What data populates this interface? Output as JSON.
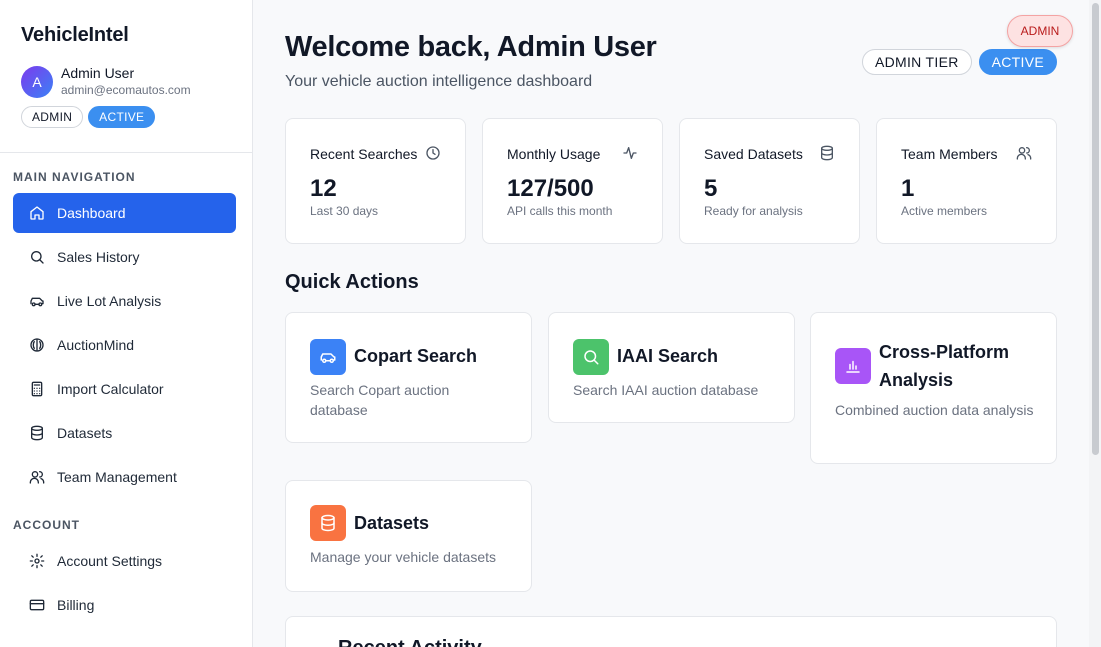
{
  "app": {
    "brand": "VehicleIntel"
  },
  "user": {
    "initial": "A",
    "name": "Admin User",
    "email": "admin@ecomautos.com",
    "role_badge": "ADMIN",
    "status_badge": "ACTIVE"
  },
  "sidebar": {
    "main_label": "MAIN NAVIGATION",
    "main_items": [
      {
        "label": "Dashboard",
        "icon": "home-icon",
        "active": true
      },
      {
        "label": "Sales History",
        "icon": "search-icon"
      },
      {
        "label": "Live Lot Analysis",
        "icon": "car-icon"
      },
      {
        "label": "AuctionMind",
        "icon": "brain-icon"
      },
      {
        "label": "Import Calculator",
        "icon": "calculator-icon"
      },
      {
        "label": "Datasets",
        "icon": "database-icon"
      },
      {
        "label": "Team Management",
        "icon": "users-icon"
      }
    ],
    "account_label": "ACCOUNT",
    "account_items": [
      {
        "label": "Account Settings",
        "icon": "gear-icon"
      },
      {
        "label": "Billing",
        "icon": "credit-card-icon"
      }
    ]
  },
  "header": {
    "title": "Welcome back, Admin User",
    "subtitle": "Your vehicle auction intelligence dashboard",
    "tier_badge": "ADMIN TIER",
    "status_badge": "ACTIVE",
    "floating_badge": "ADMIN"
  },
  "stats": [
    {
      "title": "Recent Searches",
      "value": "12",
      "sub": "Last 30 days",
      "icon": "clock-icon"
    },
    {
      "title": "Monthly Usage",
      "value": "127/500",
      "sub": "API calls this month",
      "icon": "activity-icon"
    },
    {
      "title": "Saved Datasets",
      "value": "5",
      "sub": "Ready for analysis",
      "icon": "database-icon"
    },
    {
      "title": "Team Members",
      "value": "1",
      "sub": "Active members",
      "icon": "users-icon"
    }
  ],
  "quick_actions": {
    "heading": "Quick Actions",
    "items": [
      {
        "title": "Copart Search",
        "desc": "Search Copart auction database",
        "icon": "car-icon",
        "color": "#3b82f6"
      },
      {
        "title": "IAAI Search",
        "desc": "Search IAAI auction database",
        "icon": "search-icon",
        "color": "#4cc36b"
      },
      {
        "title": "Cross-Platform Analysis",
        "desc": "Combined auction data analysis",
        "icon": "bar-chart-icon",
        "color": "#a855f7"
      },
      {
        "title": "Datasets",
        "desc": "Manage your vehicle datasets",
        "icon": "database-icon",
        "color": "#f97341"
      }
    ]
  },
  "activity": {
    "title": "Recent Activity"
  }
}
